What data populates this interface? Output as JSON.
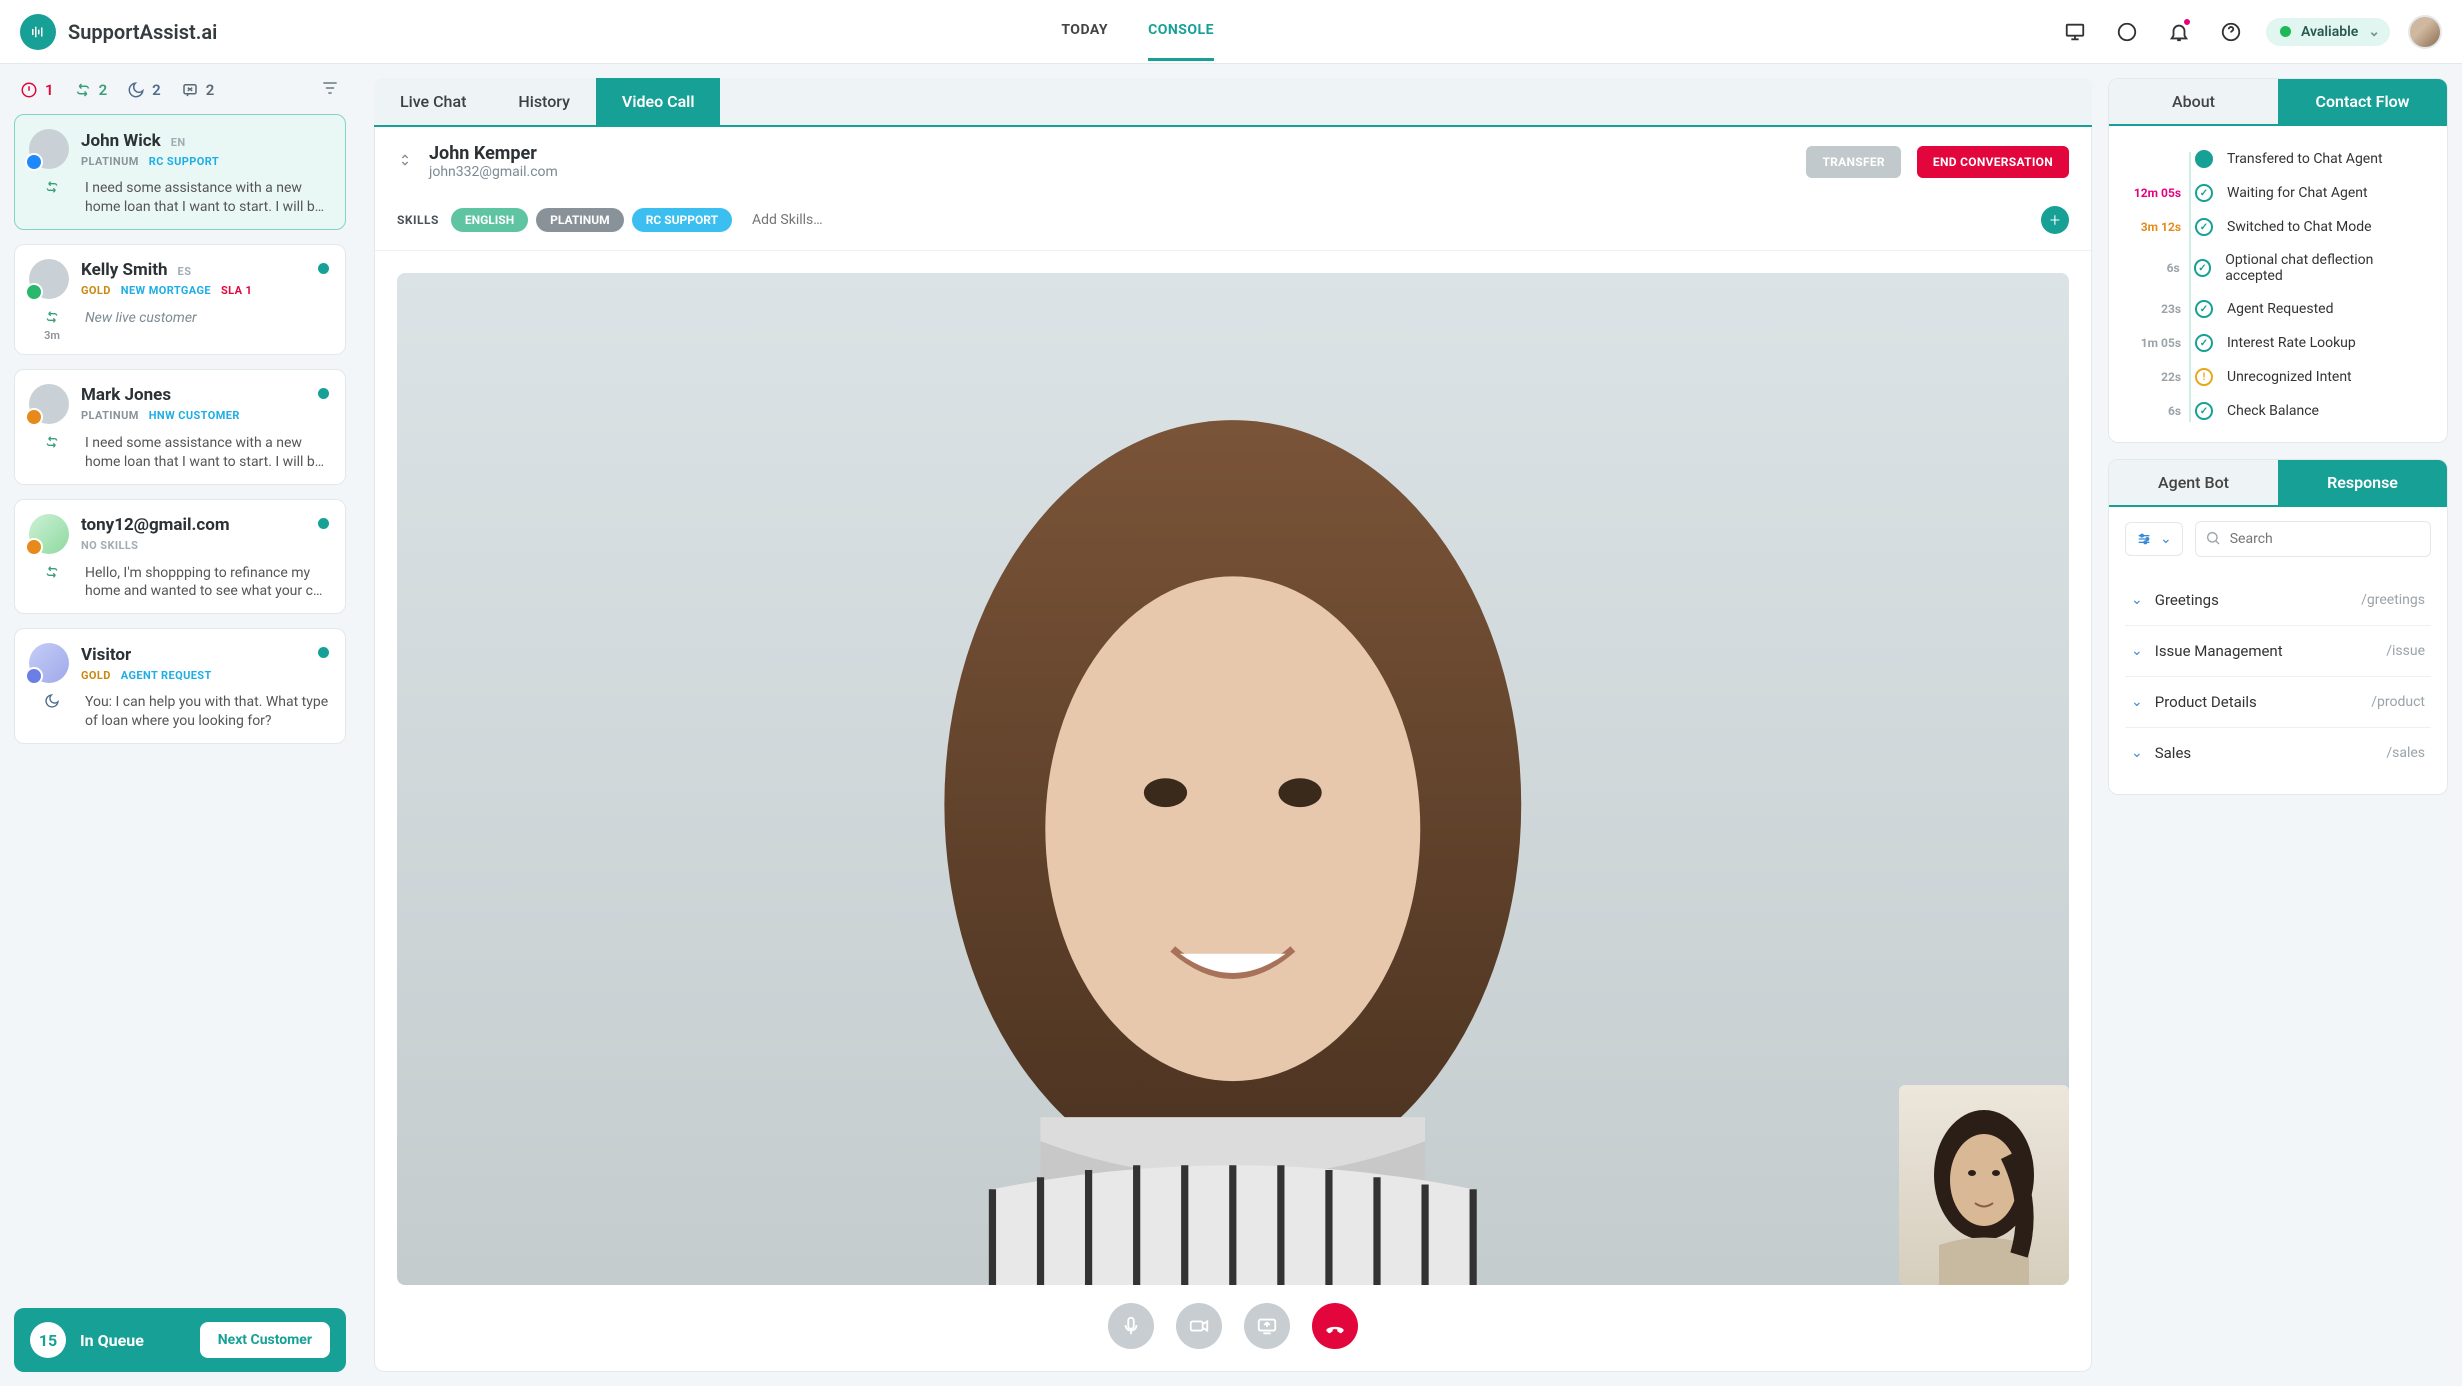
{
  "brand": "SupportAssist.ai",
  "nav": {
    "today": "TODAY",
    "console": "CONSOLE"
  },
  "availability": "Avaliable",
  "filters": {
    "alert": "1",
    "loop": "2",
    "moon": "2",
    "x": "2"
  },
  "queue": {
    "count": "15",
    "label": "In Queue",
    "next": "Next Customer"
  },
  "contacts": [
    {
      "name": "John Wick",
      "lang": "EN",
      "tags": [
        [
          "PLATINUM",
          "tag-platinum"
        ],
        [
          "RC SUPPORT",
          "tag-rc"
        ]
      ],
      "msg": "I need some assistance with a new home loan that I want to start. I will b…",
      "selected": true,
      "badge": "blue",
      "icon": "loop",
      "time": ""
    },
    {
      "name": "Kelly Smith",
      "lang": "ES",
      "tags": [
        [
          "GOLD",
          "tag-gold"
        ],
        [
          "NEW MORTGAGE",
          "tag-newm"
        ],
        [
          "SLA 1",
          "tag-sla"
        ]
      ],
      "msg": "New live customer",
      "italic": true,
      "badge": "green",
      "icon": "loop",
      "time": "3m"
    },
    {
      "name": "Mark Jones",
      "lang": "",
      "tags": [
        [
          "PLATINUM",
          "tag-platinum"
        ],
        [
          "HNW CUSTOMER",
          "tag-hnw"
        ]
      ],
      "msg": "I need some assistance with a new home loan that I want to start. I will b…",
      "badge": "orange",
      "icon": "loop",
      "time": ""
    },
    {
      "name": "tony12@gmail.com",
      "lang": "",
      "tags": [
        [
          "NO SKILLS",
          "tag-ns"
        ]
      ],
      "msg": "Hello, I'm shoppping to refinance my home and wanted to see what your c…",
      "badge": "orange",
      "icon": "loop",
      "time": "",
      "avatar": "green"
    },
    {
      "name": "Visitor",
      "lang": "",
      "tags": [
        [
          "GOLD",
          "tag-gold"
        ],
        [
          "AGENT REQUEST",
          "tag-ar"
        ]
      ],
      "msg": "You: I can help you with that. What type of loan where you looking for?",
      "badge": "purple",
      "icon": "moon",
      "time": "",
      "avatar": "purple"
    }
  ],
  "center": {
    "tabs": {
      "live": "Live Chat",
      "history": "History",
      "video": "Video Call"
    },
    "name": "John Kemper",
    "email": "john332@gmail.com",
    "transfer": "TRANSFER",
    "end": "END CONVERSATION",
    "skills_label": "SKILLS",
    "skills": [
      [
        "ENGLISH",
        "eng"
      ],
      [
        "PLATINUM",
        "plat"
      ],
      [
        "RC SUPPORT",
        "rc"
      ]
    ],
    "add_placeholder": "Add Skills…"
  },
  "flow": {
    "tabs": {
      "about": "About",
      "contact": "Contact Flow"
    },
    "items": [
      {
        "time": "",
        "label": "Transfered to Chat Agent",
        "dot": "solid"
      },
      {
        "time": "12m 05s",
        "tclass": "pink",
        "label": "Waiting for Chat Agent",
        "dot": "check"
      },
      {
        "time": "3m 12s",
        "tclass": "orange",
        "label": "Switched to Chat Mode",
        "dot": "check"
      },
      {
        "time": "6s",
        "label": "Optional chat deflection accepted",
        "dot": "check"
      },
      {
        "time": "23s",
        "label": "Agent Requested",
        "dot": "check"
      },
      {
        "time": "1m 05s",
        "label": "Interest Rate Lookup",
        "dot": "check"
      },
      {
        "time": "22s",
        "label": "Unrecognized Intent",
        "dot": "warn"
      },
      {
        "time": "6s",
        "label": "Check Balance",
        "dot": "check"
      }
    ]
  },
  "resp": {
    "tabs": {
      "bot": "Agent Bot",
      "resp": "Response"
    },
    "search_placeholder": "Search",
    "items": [
      {
        "name": "Greetings",
        "slash": "/greetings"
      },
      {
        "name": "Issue Management",
        "slash": "/issue"
      },
      {
        "name": "Product Details",
        "slash": "/product"
      },
      {
        "name": "Sales",
        "slash": "/sales"
      }
    ]
  }
}
